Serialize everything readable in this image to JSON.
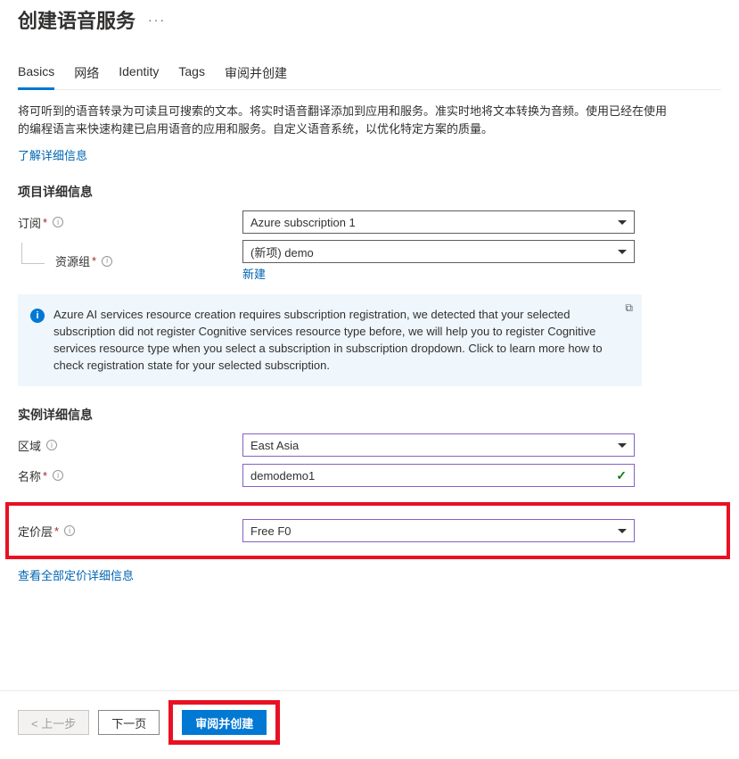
{
  "header": {
    "title": "创建语音服务",
    "more": "···"
  },
  "tabs": {
    "items": [
      {
        "label": "Basics",
        "active": true
      },
      {
        "label": "网络",
        "active": false
      },
      {
        "label": "Identity",
        "active": false
      },
      {
        "label": "Tags",
        "active": false
      },
      {
        "label": "审阅并创建",
        "active": false
      }
    ]
  },
  "intro": {
    "desc": "将可听到的语音转录为可读且可搜索的文本。将实时语音翻译添加到应用和服务。准实时地将文本转换为音频。使用已经在使用的编程语言来快速构建已启用语音的应用和服务。自定义语音系统，以优化特定方案的质量。",
    "learn_more": "了解详细信息"
  },
  "project": {
    "heading": "项目详细信息",
    "subscription_label": "订阅",
    "subscription_value": "Azure subscription 1",
    "rg_label": "资源组",
    "rg_value": "(新项) demo",
    "rg_new": "新建"
  },
  "info_box": {
    "text": "Azure AI services resource creation requires subscription registration, we detected that your selected subscription did not register Cognitive services resource type before, we will help you to register Cognitive services resource type when you select a subscription in subscription dropdown. Click to learn more how to check registration state for your selected subscription."
  },
  "instance": {
    "heading": "实例详细信息",
    "region_label": "区域",
    "region_value": "East Asia",
    "name_label": "名称",
    "name_value": "demodemo1",
    "tier_label": "定价层",
    "tier_value": "Free F0",
    "pricing_link": "查看全部定价详细信息"
  },
  "footer": {
    "prev": "< 上一步",
    "next": "下一页",
    "review": "审阅并创建"
  }
}
